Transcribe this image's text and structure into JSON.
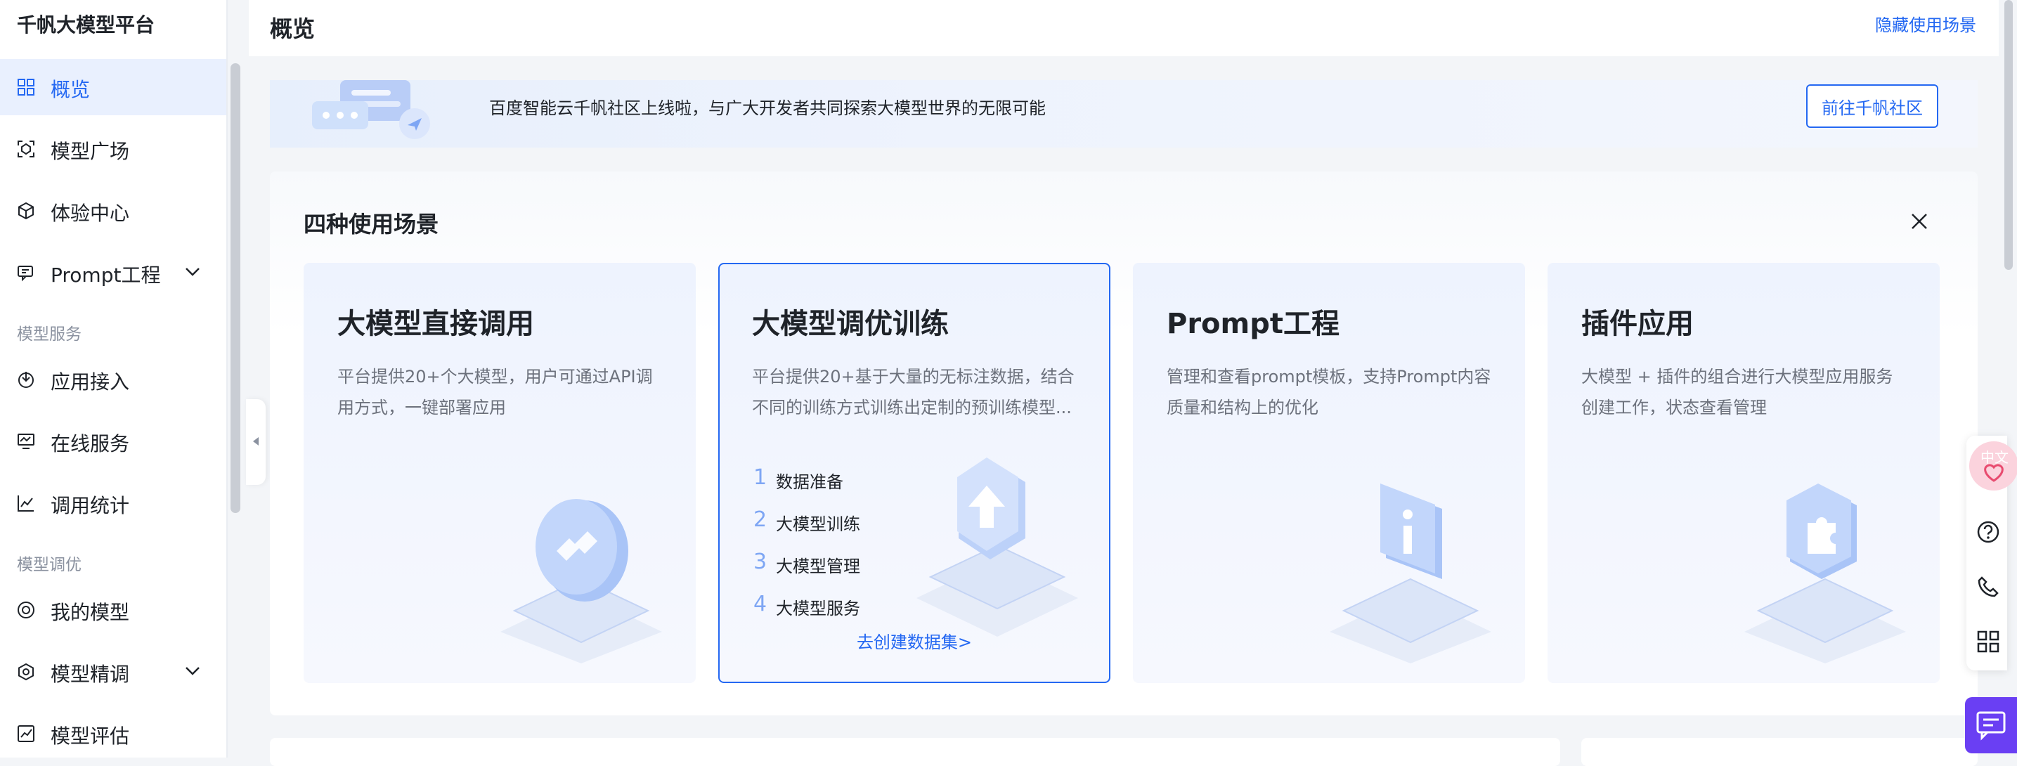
{
  "app": {
    "title": "千帆大模型平台"
  },
  "sidebar": {
    "items": [
      {
        "label": "概览",
        "icon": "grid-icon",
        "active": true
      },
      {
        "label": "模型广场",
        "icon": "model-square-icon"
      },
      {
        "label": "体验中心",
        "icon": "cube-icon"
      },
      {
        "label": "Prompt工程",
        "icon": "prompt-icon",
        "expandable": true
      }
    ],
    "groups": [
      {
        "title": "模型服务",
        "items": [
          {
            "label": "应用接入",
            "icon": "app-access-icon"
          },
          {
            "label": "在线服务",
            "icon": "monitor-icon"
          },
          {
            "label": "调用统计",
            "icon": "stats-icon"
          }
        ]
      },
      {
        "title": "模型调优",
        "items": [
          {
            "label": "我的模型",
            "icon": "my-model-icon"
          },
          {
            "label": "模型精调",
            "icon": "fine-tune-icon",
            "expandable": true
          },
          {
            "label": "模型评估",
            "icon": "evaluate-icon"
          }
        ]
      }
    ]
  },
  "header": {
    "title": "概览",
    "hide_link": "隐藏使用场景"
  },
  "banner": {
    "text": "百度智能云千帆社区上线啦，与广大开发者共同探索大模型世界的无限可能",
    "button": "前往千帆社区"
  },
  "scenarios": {
    "title": "四种使用场景",
    "cards": [
      {
        "title": "大模型直接调用",
        "desc_lines": [
          "平台提供20+个大模型，用户可通过API调",
          "用方式，一键部署应用"
        ],
        "illus": "link-icon"
      },
      {
        "title": "大模型调优训练",
        "desc_lines": [
          "平台提供20+基于大量的无标注数据，结合",
          "不同的训练方式训练出定制的预训练模型..."
        ],
        "steps": [
          {
            "num": "1",
            "label": "数据准备"
          },
          {
            "num": "2",
            "label": "大模型训练"
          },
          {
            "num": "3",
            "label": "大模型管理"
          },
          {
            "num": "4",
            "label": "大模型服务"
          }
        ],
        "link": "去创建数据集>",
        "selected": true,
        "illus": "arrow-up-icon"
      },
      {
        "title": "Prompt工程",
        "desc_lines": [
          "管理和查看prompt模板，支持Prompt内容",
          "质量和结构上的优化"
        ],
        "illus": "info-icon"
      },
      {
        "title": "插件应用",
        "desc_lines": [
          "大模型 + 插件的组合进行大模型应用服务",
          "创建工作，状态查看管理"
        ],
        "illus": "puzzle-icon"
      }
    ]
  },
  "floating_toolbar": {
    "badge_label": "中文",
    "buttons": [
      "help-icon",
      "phone-icon",
      "apps-icon"
    ],
    "chat": "chat-icon"
  },
  "colors": {
    "accent": "#2468f2",
    "active_bg": "#e9f0fe",
    "chat_btn": "#6a3ff3"
  }
}
